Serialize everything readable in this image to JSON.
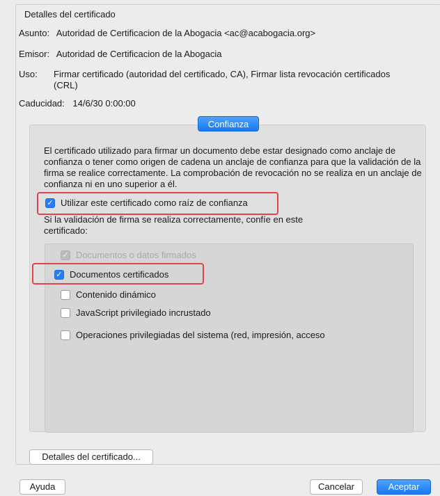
{
  "section_title": "Detalles del certificado",
  "subject": {
    "label": "Asunto:",
    "value": "Autoridad de Certificacion de la Abogacia <ac@acabogacia.org>"
  },
  "issuer": {
    "label": "Emisor:",
    "value": "Autoridad de Certificacion de la Abogacia"
  },
  "usage": {
    "label": "Uso:",
    "value_line1": "Firmar certificado (autoridad del certificado, CA), Firmar lista revocación certificados",
    "value_line2": "(CRL)"
  },
  "expiry": {
    "label": "Caducidad:",
    "value": "14/6/30 0:00:00"
  },
  "tab_label": "Confianza",
  "description": "El certificado utilizado para firmar un documento debe estar designado como anclaje de confianza o tener como origen de cadena un anclaje de confianza para que la validación de la firma se realice correctamente. La comprobación de revocación no se realiza en un anclaje de confianza ni en uno superior a él.",
  "root_checkbox": {
    "label": "Utilizar este certificado como raíz de confianza",
    "checked": true
  },
  "trust_note": "Si la validación de firma se realiza correctamente, confíe en este certificado:",
  "trust_options": [
    {
      "label": "Documentos o datos firmados",
      "checked": true,
      "disabled": true
    },
    {
      "label": "Documentos certificados",
      "checked": true,
      "disabled": false
    },
    {
      "label": "Contenido dinámico",
      "checked": false,
      "disabled": false
    },
    {
      "label": "JavaScript privilegiado incrustado",
      "checked": false,
      "disabled": false
    },
    {
      "label": "Operaciones privilegiadas del sistema (red, impresión, acceso",
      "checked": false,
      "disabled": false
    }
  ],
  "buttons": {
    "details": "Detalles del certificado...",
    "help": "Ayuda",
    "cancel": "Cancelar",
    "accept": "Aceptar"
  },
  "colors": {
    "accent": "#1a78f2",
    "highlight": "#e0434c"
  }
}
